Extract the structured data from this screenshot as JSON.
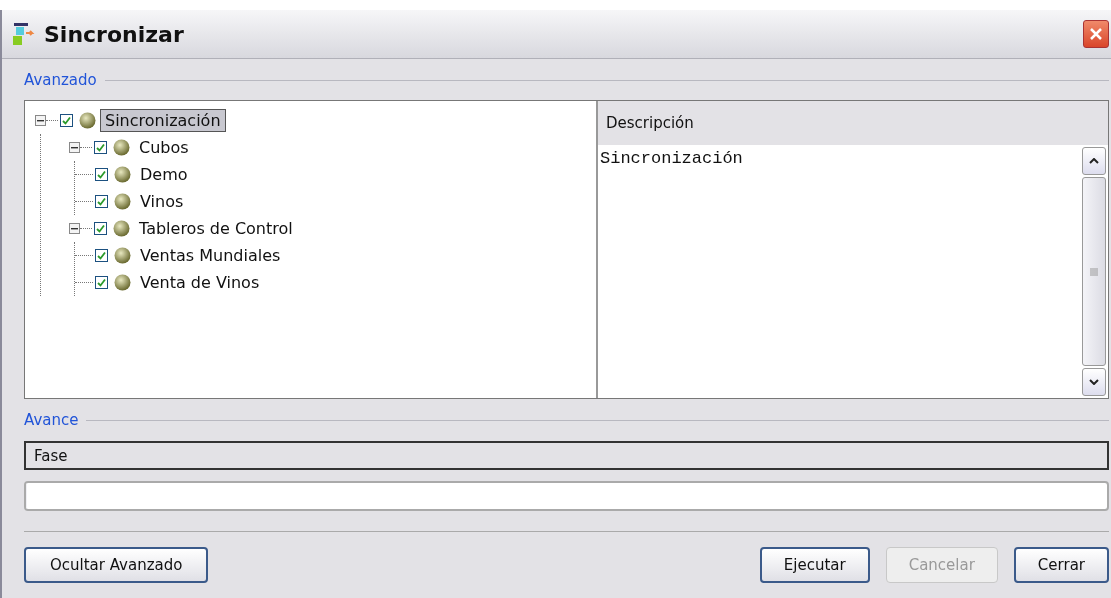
{
  "window": {
    "title": "Sincronizar"
  },
  "advanced": {
    "legend": "Avanzado",
    "tree": [
      {
        "label": "Sincronización",
        "checked": true,
        "selected": true,
        "expanded": true,
        "children": [
          {
            "label": "Cubos",
            "checked": true,
            "selected": false,
            "expanded": true,
            "children": [
              {
                "label": "Demo",
                "checked": true,
                "selected": false
              },
              {
                "label": "Vinos",
                "checked": true,
                "selected": false
              }
            ]
          },
          {
            "label": "Tableros de Control",
            "checked": true,
            "selected": false,
            "expanded": true,
            "children": [
              {
                "label": "Ventas Mundiales",
                "checked": true,
                "selected": false
              },
              {
                "label": "Venta de Vinos",
                "checked": true,
                "selected": false
              }
            ]
          }
        ]
      }
    ],
    "description": {
      "header": "Descripción",
      "text": "Sincronización"
    }
  },
  "progress": {
    "legend": "Avance",
    "phase": "Fase",
    "level": 0
  },
  "buttons": [
    {
      "label": "Ocultar Avanzado",
      "disabled": false
    },
    {
      "label": "Ejecutar",
      "disabled": false
    },
    {
      "label": "Cancelar",
      "disabled": true
    },
    {
      "label": "Cerrar",
      "disabled": false
    }
  ]
}
